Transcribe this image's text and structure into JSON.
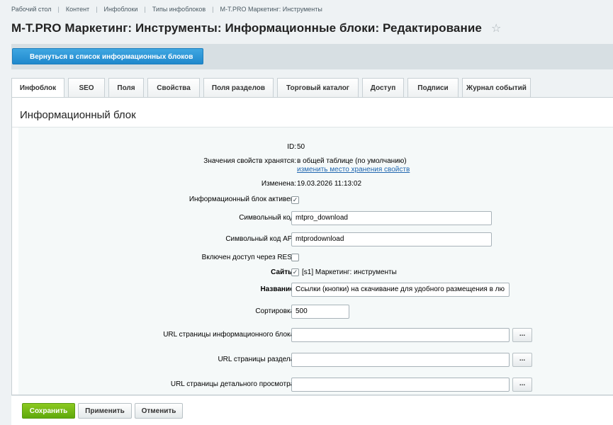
{
  "breadcrumbs": [
    "Рабочий стол",
    "Контент",
    "Инфоблоки",
    "Типы инфоблоков",
    "M-T.PRO Маркетинг: Инструменты"
  ],
  "header": {
    "title": "M-T.PRO Маркетинг: Инструменты: Информационные блоки: Редактирование",
    "star": "☆"
  },
  "back_button": "Вернуться в список информационных блоков",
  "tabs": [
    "Инфоблок",
    "SEO",
    "Поля",
    "Свойства",
    "Поля разделов",
    "Торговый каталог",
    "Доступ",
    "Подписи",
    "Журнал событий"
  ],
  "section_title": "Информационный блок",
  "form": {
    "id": {
      "label": "ID:",
      "value": "50"
    },
    "storage": {
      "label": "Значения свойств хранятся:",
      "value": "в общей таблице (по умолчанию)",
      "link": "изменить место хранения свойств"
    },
    "changed": {
      "label": "Изменена:",
      "value": "19.03.2026 11:13:02"
    },
    "active": {
      "label": "Информационный блок активен:",
      "checked": true
    },
    "code": {
      "label": "Символьный код:",
      "value": "mtpro_download"
    },
    "api_code": {
      "label": "Символьный код API:",
      "value": "mtprodownload"
    },
    "rest": {
      "label": "Включен доступ через REST",
      "checked": false
    },
    "sites": {
      "label": "Сайты:",
      "checked": true,
      "value": "[s1] Маркетинг: инструменты"
    },
    "name": {
      "label": "Название:",
      "value": "Ссылки (кнопки) на скачивание для удобного размещения в лю"
    },
    "sort": {
      "label": "Сортировка:",
      "value": "500"
    },
    "list_url": {
      "label": "URL страницы информационного блока:",
      "value": ""
    },
    "section_url": {
      "label": "URL страницы раздела:",
      "value": ""
    },
    "detail_url": {
      "label": "URL страницы детального просмотра:",
      "value": ""
    },
    "dots": "..."
  },
  "buttons": {
    "save": "Сохранить",
    "apply": "Применить",
    "cancel": "Отменить"
  },
  "colors": {
    "accent_blue": "#2b97d8",
    "save_green": "#72b816",
    "link": "#2067b0"
  }
}
